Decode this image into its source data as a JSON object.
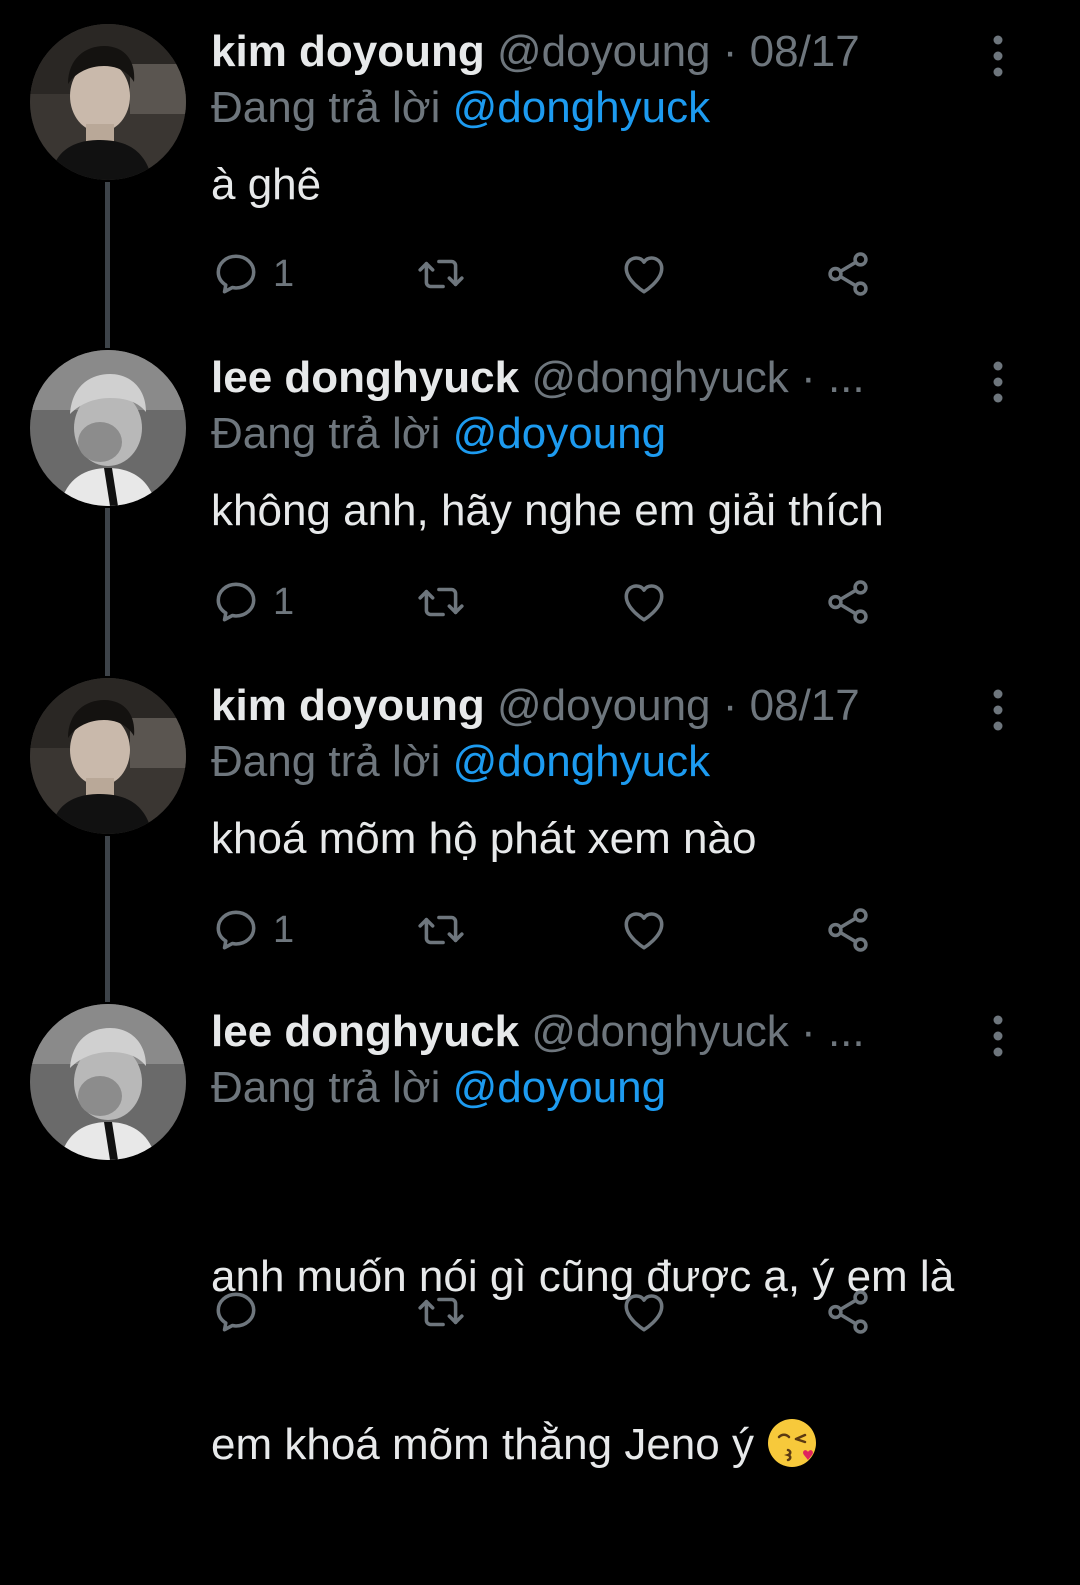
{
  "tweets": [
    {
      "name": "kim doyoung",
      "handle": "@doyoung",
      "separator": "·",
      "date": "08/17",
      "replying_prefix": "Đang trả lời",
      "replying_to": "@donghyuck",
      "text": "à ghê",
      "reply_count": "1",
      "avatar": "doyoung-photo"
    },
    {
      "name": "lee donghyuck",
      "handle": "@donghyuck",
      "separator": "·",
      "date": "...",
      "replying_prefix": "Đang trả lời",
      "replying_to": "@doyoung",
      "text": "không anh, hãy nghe em giải thích",
      "reply_count": "1",
      "avatar": "donghyuck-photo"
    },
    {
      "name": "kim doyoung",
      "handle": "@doyoung",
      "separator": "·",
      "date": "08/17",
      "replying_prefix": "Đang trả lời",
      "replying_to": "@donghyuck",
      "text": "khoá mõm hộ phát xem nào",
      "reply_count": "1",
      "avatar": "doyoung-photo"
    },
    {
      "name": "lee donghyuck",
      "handle": "@donghyuck",
      "separator": "·",
      "date": "...",
      "replying_prefix": "Đang trả lời",
      "replying_to": "@doyoung",
      "text_line1": "anh muốn nói gì cũng được ạ, ý em là",
      "text_line2": "em khoá mõm thằng Jeno ý",
      "emoji": "kissing-face-emoji",
      "reply_count": "",
      "avatar": "donghyuck-photo"
    }
  ],
  "icons": {
    "reply": "reply-icon",
    "retweet": "retweet-icon",
    "like": "heart-icon",
    "share": "share-icon",
    "more": "more-vertical-icon"
  },
  "colors": {
    "background": "#000000",
    "text": "#e7e9ea",
    "muted": "#6e767d",
    "mention": "#1d9bf0",
    "thread_line": "#3d4349"
  }
}
